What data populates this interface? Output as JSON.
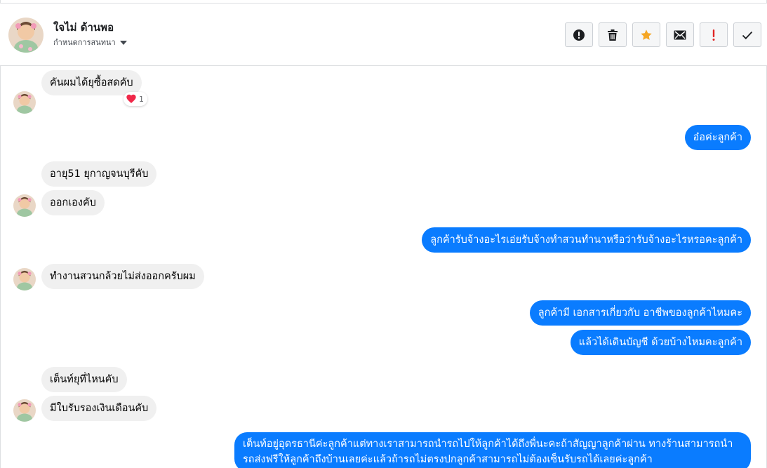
{
  "header": {
    "contact_name": "ใจไม่ ด้านพอ",
    "assign_label": "กำหนดการสนทนา",
    "actions": [
      {
        "name": "report-spam-button",
        "icon": "alert-circle-icon"
      },
      {
        "name": "delete-button",
        "icon": "trash-icon"
      },
      {
        "name": "star-button",
        "icon": "star-icon"
      },
      {
        "name": "mark-unread-button",
        "icon": "envelope-icon"
      },
      {
        "name": "follow-up-button",
        "icon": "exclamation-icon"
      },
      {
        "name": "mark-done-button",
        "icon": "checkmark-icon"
      }
    ],
    "colors": {
      "star": "#f5a623",
      "follow_up": "#e02424"
    }
  },
  "messages": [
    {
      "from": "customer",
      "text": "คันผมได้ยุซื้อสดคับ",
      "reaction": {
        "icon": "heart-icon",
        "count": "1"
      }
    },
    {
      "from": "page",
      "text": "อ๋อค่ะลูกค้า"
    },
    {
      "from": "customer",
      "text": "อายุ51 ยุกาญจนบุรีคับ"
    },
    {
      "from": "customer",
      "text": "ออกเองคับ"
    },
    {
      "from": "page",
      "text": "ลูกค้ารับจ้างอะไรเอ่ยรับจ้างทำสวนทำนาหรือว่ารับจ้างอะไรหรอคะลูกค้า"
    },
    {
      "from": "customer",
      "text": "ทำงานสวนกล้วยไม่ส่งออกครับผม"
    },
    {
      "from": "page",
      "text": "ลูกค้ามี เอกสารเกี่ยวกับ อาชีพของลูกค้าไหมคะ"
    },
    {
      "from": "page",
      "text": "แล้วได้เดินบัญชี ด้วยบ้างไหมคะลูกค้า"
    },
    {
      "from": "customer",
      "text": "เต็นท์ยุที่ไหนคับ"
    },
    {
      "from": "customer",
      "text": "มีใบรับรองเงินเดือนคับ"
    },
    {
      "from": "page",
      "text": "เต็นท์อยู่อุดรธานีค่ะลูกค้าแต่ทางเราสามารถนำรถไปให้ลูกค้าได้ถึงพื่นะคะถ้าสัญญาลูกค้าผ่าน ทางร้านสามารถนำรถส่งฟรีให้ลูกค้าถึงบ้านเลยค่ะแล้วถ้ารถไม่ตรงปกลูกค้าสามารถไม่ต้องเซ็นรับรถได้เลยค่ะลูกค้า"
    }
  ],
  "colors": {
    "outgoing_bubble": "#0a7cff",
    "incoming_bubble": "#f0f0f0",
    "reaction_heart": "#f02849"
  }
}
